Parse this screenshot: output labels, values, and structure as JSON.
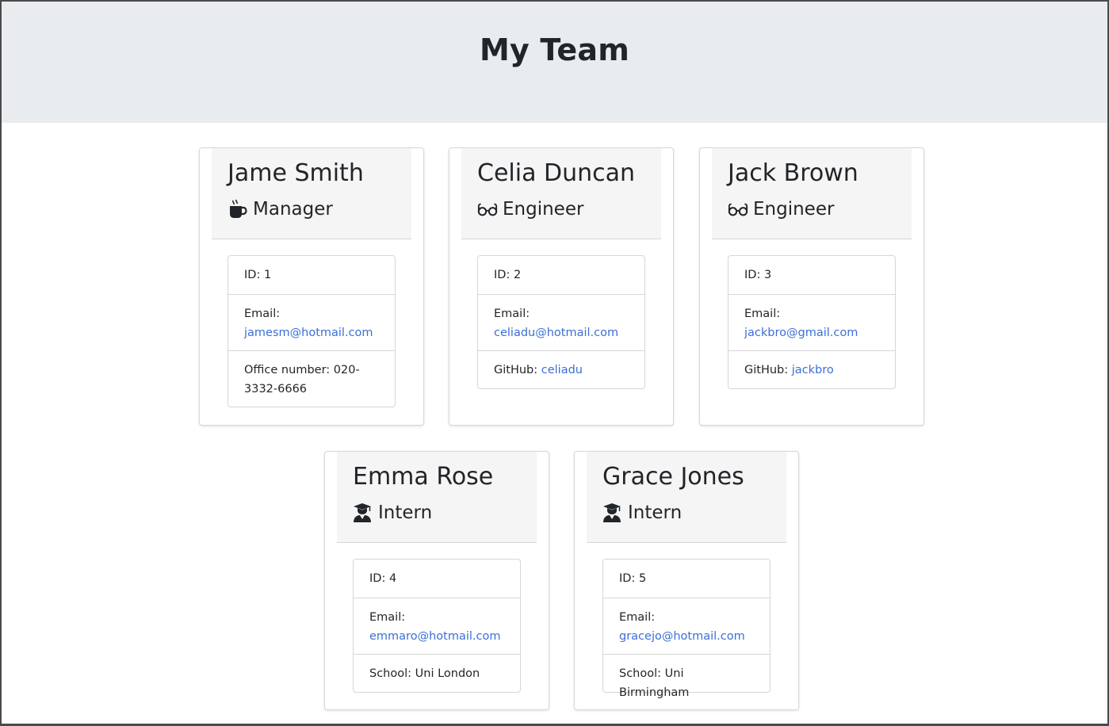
{
  "header": {
    "title": "My Team"
  },
  "team": [
    {
      "name": "Jame Smith",
      "role": "Manager",
      "icon": "coffee-icon",
      "id_label": "ID:",
      "id": "1",
      "email_label": "Email:",
      "email": "jamesm@hotmail.com",
      "extra_label": "Office number:",
      "extra_value": "020-3332-6666"
    },
    {
      "name": "Celia Duncan",
      "role": "Engineer",
      "icon": "glasses-icon",
      "id_label": "ID:",
      "id": "2",
      "email_label": "Email:",
      "email": "celiadu@hotmail.com",
      "extra_label": "GitHub:",
      "extra_value": "celiadu"
    },
    {
      "name": "Jack Brown",
      "role": "Engineer",
      "icon": "glasses-icon",
      "id_label": "ID:",
      "id": "3",
      "email_label": "Email:",
      "email": "jackbro@gmail.com",
      "extra_label": "GitHub:",
      "extra_value": "jackbro"
    },
    {
      "name": "Emma Rose",
      "role": "Intern",
      "icon": "graduate-icon",
      "id_label": "ID:",
      "id": "4",
      "email_label": "Email:",
      "email": "emmaro@hotmail.com",
      "extra_label": "School:",
      "extra_value": "Uni London"
    },
    {
      "name": "Grace Jones",
      "role": "Intern",
      "icon": "graduate-icon",
      "id_label": "ID:",
      "id": "5",
      "email_label": "Email:",
      "email": "gracejo@hotmail.com",
      "extra_label": "School:",
      "extra_value": "Uni Birmingham"
    }
  ],
  "colors": {
    "link": "#3b6fd6",
    "jumbotron": "#e9ecef",
    "card_header": "#f5f5f5"
  }
}
